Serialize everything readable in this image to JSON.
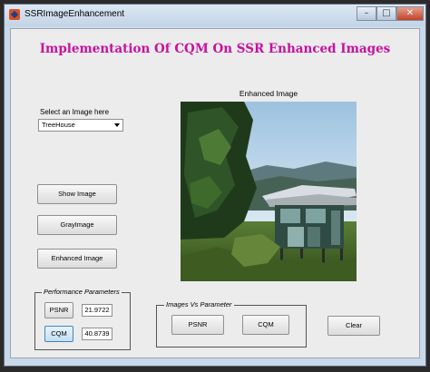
{
  "window": {
    "title": "SSRImageEnhancement",
    "controls": {
      "minimize": "–",
      "maximize": "□",
      "close": "✕"
    }
  },
  "header": {
    "title": "Implementation Of CQM On SSR Enhanced Images"
  },
  "selector": {
    "label": "Select an Image here",
    "value": "TreeHouse"
  },
  "buttons": {
    "show_image": "Show Image",
    "gray_image": "GrayImage",
    "enhanced_image": "Enhanced Image",
    "psnr_small": "PSNR",
    "cqm_small": "CQM",
    "psnr_big": "PSNR",
    "cqm_big": "CQM",
    "clear": "Clear"
  },
  "performance": {
    "legend": "Performance Parameters",
    "psnr_value": "21.9722",
    "cqm_value": "40.8739"
  },
  "image_panel": {
    "label": "Enhanced Image"
  },
  "images_vs_parameter": {
    "legend": "Images Vs Parameter"
  },
  "colors": {
    "title": "#c8109f",
    "window_frame": "#c9d9ea",
    "client_bg": "#ececec"
  },
  "icons": {
    "app_icon": "matlab-icon",
    "dropdown": "chevron-down-icon"
  }
}
